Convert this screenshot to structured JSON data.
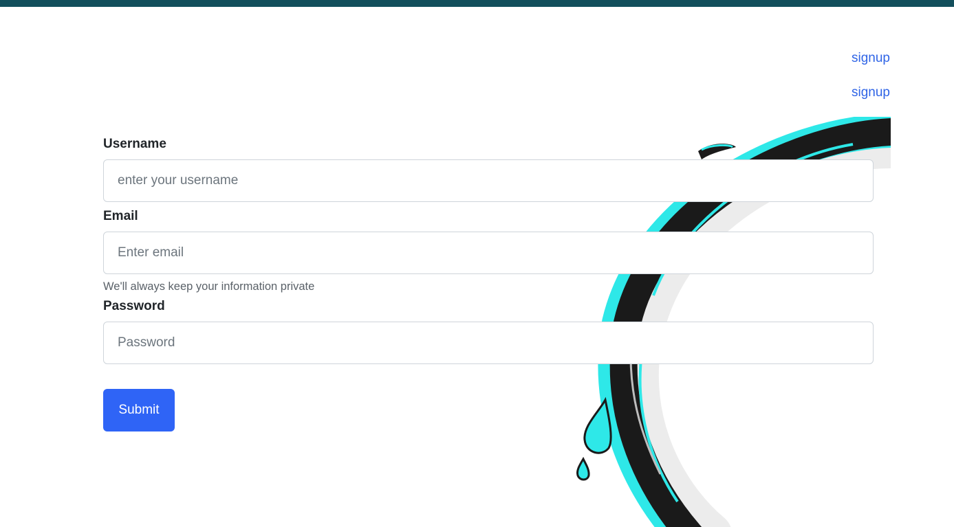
{
  "header": {
    "links": [
      "signup",
      "signup"
    ]
  },
  "form": {
    "username": {
      "label": "Username",
      "placeholder": "enter your username"
    },
    "email": {
      "label": "Email",
      "placeholder": "Enter email",
      "help": "We'll always keep your information private"
    },
    "password": {
      "label": "Password",
      "placeholder": "Password"
    },
    "submit_label": "Submit"
  },
  "colors": {
    "topbar": "#134f5c",
    "link": "#2f64e6",
    "button": "#2f64f6",
    "swirl_accent": "#2ee8e8",
    "swirl_dark": "#1a1a1a"
  },
  "background_image": "ink-brush-circle-logo"
}
